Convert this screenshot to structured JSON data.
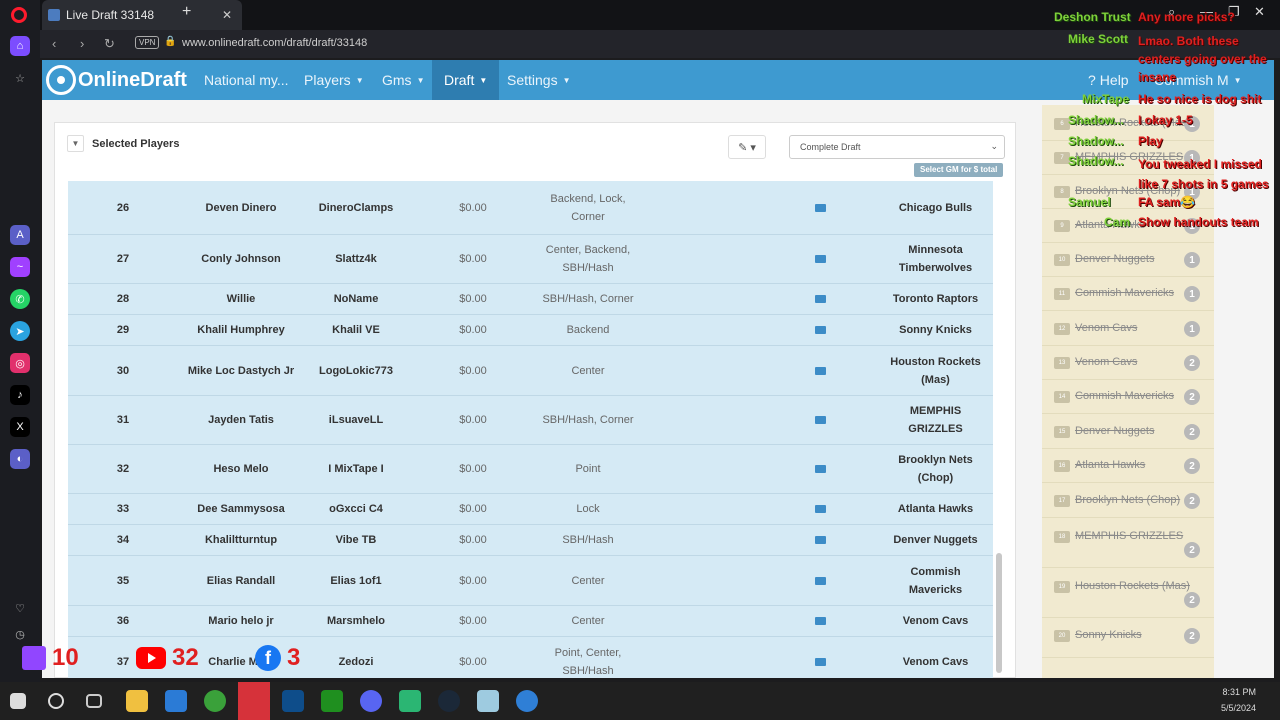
{
  "browser": {
    "tab_title": "Live Draft 33148",
    "url": "www.onlinedraft.com/draft/draft/33148",
    "vpn_label": "VPN"
  },
  "site": {
    "brand": "OnlineDraft",
    "nav": [
      {
        "label": "National my..."
      },
      {
        "label": "Players"
      },
      {
        "label": "Gms"
      },
      {
        "label": "Draft"
      },
      {
        "label": "Settings"
      }
    ],
    "help_label": "Help",
    "user_label": "Commish M"
  },
  "panel": {
    "title": "Selected Players",
    "select_value": "Complete Draft",
    "gm_badge": "Select GM for $ total"
  },
  "rows": [
    {
      "pick": "26",
      "name": "Deven Dinero",
      "gamertag": "DineroClamps",
      "salary": "$0.00",
      "positions": "Backend, Lock, Corner",
      "team": "Chicago Bulls"
    },
    {
      "pick": "27",
      "name": "Conly Johnson",
      "gamertag": "Slattz4k",
      "salary": "$0.00",
      "positions": "Center, Backend, SBH/Hash",
      "team": "Minnesota Timberwolves"
    },
    {
      "pick": "28",
      "name": "Willie",
      "gamertag": "NoName",
      "salary": "$0.00",
      "positions": "SBH/Hash, Corner",
      "team": "Toronto Raptors"
    },
    {
      "pick": "29",
      "name": "Khalil Humphrey",
      "gamertag": "Khalil VE",
      "salary": "$0.00",
      "positions": "Backend",
      "team": "Sonny Knicks"
    },
    {
      "pick": "30",
      "name": "Mike Loc Dastych Jr",
      "gamertag": "LogoLokic773",
      "salary": "$0.00",
      "positions": "Center",
      "team": "Houston Rockets (Mas)"
    },
    {
      "pick": "31",
      "name": "Jayden Tatis",
      "gamertag": "iLsuaveLL",
      "salary": "$0.00",
      "positions": "SBH/Hash, Corner",
      "team": "MEMPHIS GRIZZLES"
    },
    {
      "pick": "32",
      "name": "Heso Melo",
      "gamertag": "I MixTape I",
      "salary": "$0.00",
      "positions": "Point",
      "team": "Brooklyn Nets (Chop)"
    },
    {
      "pick": "33",
      "name": "Dee Sammysosa",
      "gamertag": "oGxcci C4",
      "salary": "$0.00",
      "positions": "Lock",
      "team": "Atlanta Hawks"
    },
    {
      "pick": "34",
      "name": "Khaliltturntup",
      "gamertag": "Vibe TB",
      "salary": "$0.00",
      "positions": "SBH/Hash",
      "team": "Denver Nuggets"
    },
    {
      "pick": "35",
      "name": "Elias Randall",
      "gamertag": "Elias 1of1",
      "salary": "$0.00",
      "positions": "Center",
      "team": "Commish Mavericks"
    },
    {
      "pick": "36",
      "name": "Mario helo jr",
      "gamertag": "Marsmhelo",
      "salary": "$0.00",
      "positions": "Center",
      "team": "Venom Cavs"
    },
    {
      "pick": "37",
      "name": "Charlie Mu...",
      "gamertag": "Zedozi",
      "salary": "$0.00",
      "positions": "Point, Center, SBH/Hash",
      "team": "Venom Cavs"
    }
  ],
  "queue": [
    {
      "num": "6",
      "team": "Houston Rockets (Mas)",
      "round": "1"
    },
    {
      "num": "7",
      "team": "MEMPHIS GRIZZLES",
      "round": "1"
    },
    {
      "num": "8",
      "team": "Brooklyn Nets (Chop)",
      "round": "1"
    },
    {
      "num": "9",
      "team": "Atlanta Hawks",
      "round": "1"
    },
    {
      "num": "10",
      "team": "Denver Nuggets",
      "round": "1"
    },
    {
      "num": "11",
      "team": "Commish Mavericks",
      "round": "1"
    },
    {
      "num": "12",
      "team": "Venom Cavs",
      "round": "1"
    },
    {
      "num": "13",
      "team": "Venom Cavs",
      "round": "2"
    },
    {
      "num": "14",
      "team": "Commish Mavericks",
      "round": "2"
    },
    {
      "num": "15",
      "team": "Denver Nuggets",
      "round": "2"
    },
    {
      "num": "16",
      "team": "Atlanta Hawks",
      "round": "2"
    },
    {
      "num": "17",
      "team": "Brooklyn Nets (Chop)",
      "round": "2"
    },
    {
      "num": "18",
      "team": "MEMPHIS GRIZZLES",
      "round": "2"
    },
    {
      "num": "19",
      "team": "Houston Rockets (Mas)",
      "round": "2"
    },
    {
      "num": "20",
      "team": "Sonny Knicks",
      "round": "2"
    }
  ],
  "chat": [
    {
      "name": "Deshon Trust",
      "msg": "Any more picks?"
    },
    {
      "name": "Mike Scott",
      "msg": "Lmao. Both these centers going over the insane"
    },
    {
      "name": "MixTape",
      "msg": "He so nice is dog shit"
    },
    {
      "name": "Shadow...",
      "msg": "I okay 1-5"
    },
    {
      "name": "Shadow...",
      "msg": "Play"
    },
    {
      "name": "Shadow...",
      "msg": "You tweaked I missed like 7 shots in 5 games"
    },
    {
      "name": "Samuel",
      "msg": "FA sam😂"
    },
    {
      "name": "Cam",
      "msg": "Show handouts team"
    }
  ],
  "counters": {
    "twitch": "10",
    "youtube": "32",
    "facebook": "3"
  },
  "clock": {
    "time": "8:31 PM",
    "date": "5/5/2024"
  }
}
